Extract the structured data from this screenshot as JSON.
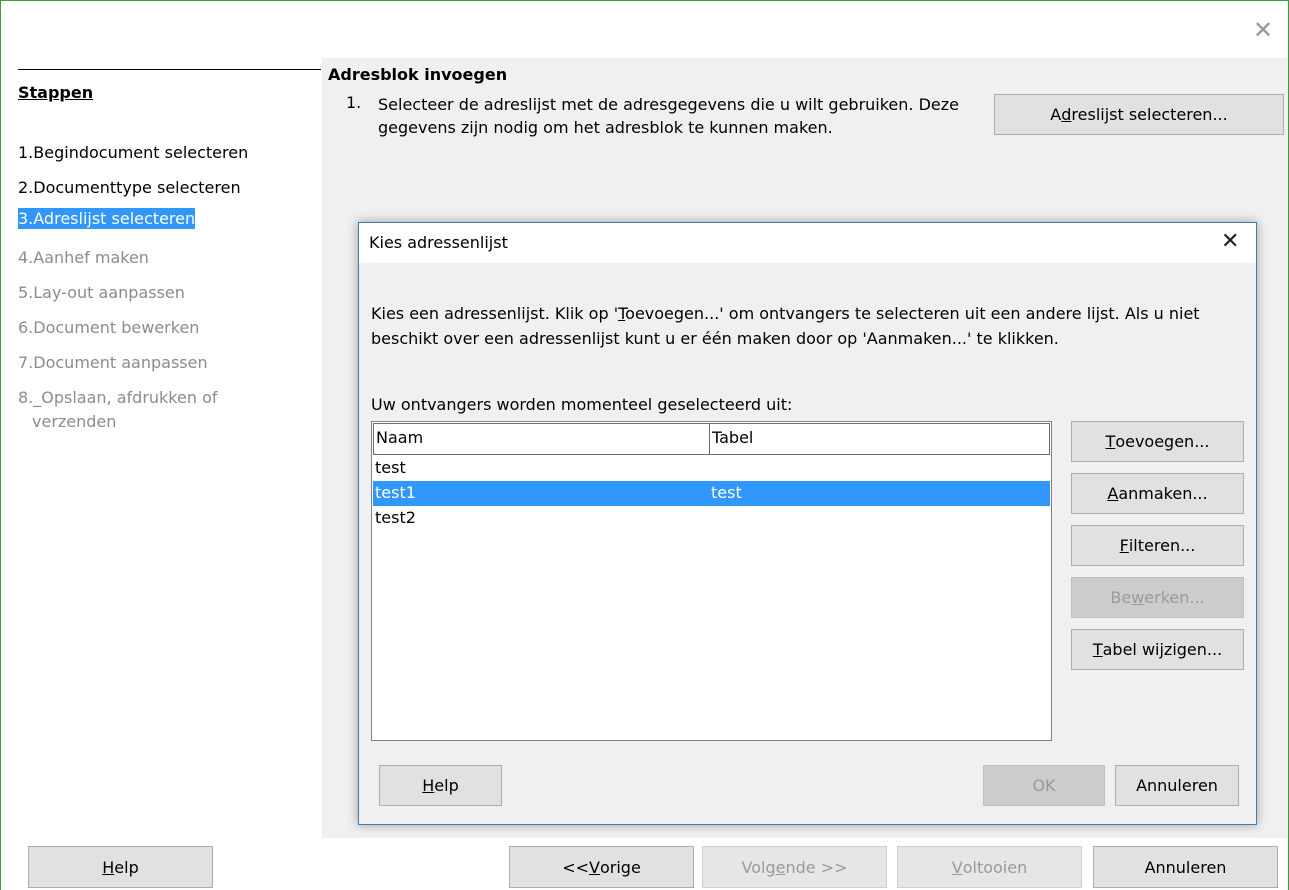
{
  "window": {
    "close_glyph": "✕"
  },
  "steps": {
    "title": "Stappen",
    "items": [
      {
        "num": "1.",
        "label": "Begindocument selecteren",
        "state": "enabled"
      },
      {
        "num": "2.",
        "label": "Documenttype selecteren",
        "state": "enabled"
      },
      {
        "num": "3.",
        "label": "Adreslijst selecteren",
        "state": "selected"
      },
      {
        "num": "4.",
        "label": "Aanhef maken",
        "state": "disabled"
      },
      {
        "num": "5.",
        "label": "Lay-out aanpassen",
        "state": "disabled"
      },
      {
        "num": "6.",
        "label": "Document bewerken",
        "state": "disabled"
      },
      {
        "num": "7.",
        "label": "Document aanpassen",
        "state": "disabled"
      },
      {
        "num": "8.",
        "label": "_Opslaan, afdrukken of",
        "label2": "verzenden",
        "state": "disabled"
      }
    ]
  },
  "main": {
    "section_title": "Adresblok invoegen",
    "step_number": "1.",
    "step_text": "Selecteer de adreslijst met de adresgegevens die u wilt gebruiken. Deze gegevens zijn nodig om het adresblok te kunnen maken.",
    "select_button": {
      "before": "A",
      "mnemonic": "d",
      "after": "reslijst selecteren..."
    }
  },
  "dialog": {
    "title": "Kies adressenlijst",
    "close_glyph": "✕",
    "description_before": "Kies een adressenlijst. Klik op '",
    "description_mnemonic": "T",
    "description_after": "oevoegen...' om ontvangers te selecteren uit een andere lijst. Als u niet beschikt over een adressenlijst kunt u er één maken door op 'Aanmaken...' te klikken.",
    "subtitle": "Uw ontvangers worden momenteel geselecteerd uit:",
    "columns": [
      "Naam",
      "Tabel"
    ],
    "rows": [
      {
        "naam": "test",
        "tabel": "",
        "selected": false
      },
      {
        "naam": "test1",
        "tabel": "test",
        "selected": true
      },
      {
        "naam": "test2",
        "tabel": "",
        "selected": false
      }
    ],
    "buttons": {
      "toevoegen": {
        "mnemonic": "T",
        "rest": "oevoegen..."
      },
      "aanmaken": {
        "mnemonic": "A",
        "rest": "anmaken..."
      },
      "filteren": {
        "mnemonic": "F",
        "rest": "ilteren..."
      },
      "bewerken": {
        "before": "Be",
        "mnemonic": "w",
        "after": "erken..."
      },
      "tabel": {
        "mnemonic": "T",
        "rest": "abel wijzigen..."
      },
      "help": {
        "mnemonic": "H",
        "rest": "elp"
      },
      "ok": "OK",
      "annuleren": "Annuleren"
    }
  },
  "footer": {
    "help": {
      "mnemonic": "H",
      "rest": "elp"
    },
    "vorige": {
      "before": "<< ",
      "mnemonic": "V",
      "after": "orige"
    },
    "volgende": {
      "before": "Volg",
      "mnemonic": "e",
      "after": "nde >>"
    },
    "voltooien": {
      "mnemonic": "V",
      "rest": "oltooien"
    },
    "annuleren": "Annuleren"
  },
  "colors": {
    "selection": "#3297fd",
    "frame": "#3a9c3a",
    "dialog_border": "#3c7fb1"
  }
}
